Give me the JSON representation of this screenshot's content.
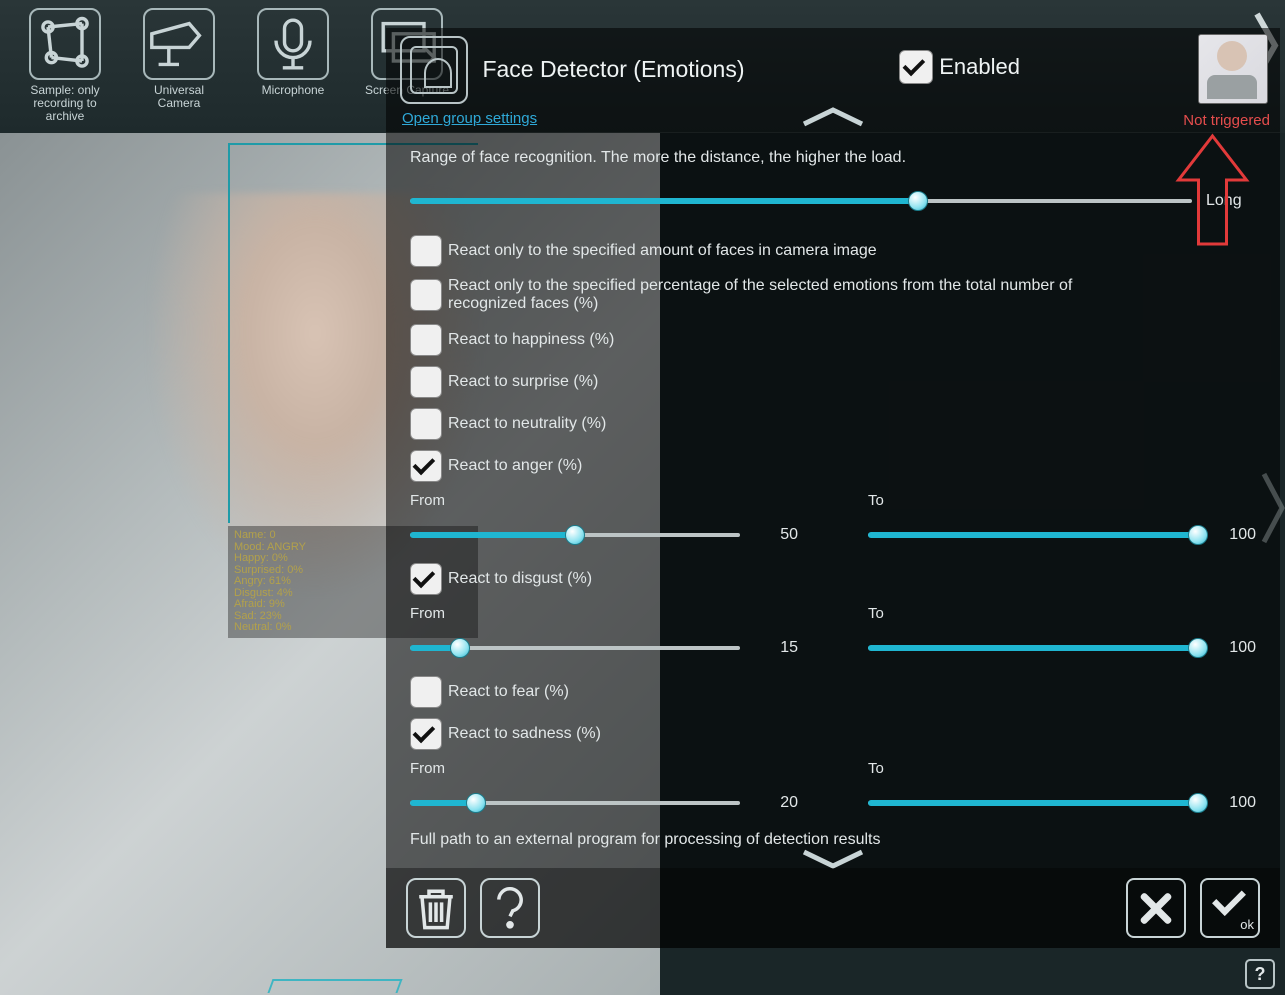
{
  "toolbar": {
    "items": [
      {
        "label": "Sample: only recording to archive"
      },
      {
        "label": "Universal Camera"
      },
      {
        "label": "Microphone"
      },
      {
        "label": "Screen Capture"
      }
    ]
  },
  "panel": {
    "title": "Face Detector (Emotions)",
    "open_group": "Open group settings",
    "enabled_label": "Enabled",
    "enabled_checked": true,
    "not_triggered": "Not triggered",
    "desc": "Range of face recognition. The more the distance, the higher the load.",
    "range_suffix": "Long",
    "range_percent": 65,
    "opts": {
      "faces_count": {
        "label": "React only to the specified amount of faces in camera image",
        "checked": false
      },
      "faces_percent": {
        "label": "React only to the specified percentage of the selected emotions from the total number of recognized faces (%)",
        "checked": false
      },
      "happiness": {
        "label": "React to happiness (%)",
        "checked": false
      },
      "surprise": {
        "label": "React to surprise (%)",
        "checked": false
      },
      "neutrality": {
        "label": "React to neutrality (%)",
        "checked": false
      },
      "anger": {
        "label": "React to anger (%)",
        "checked": true,
        "from": 50,
        "to": 100
      },
      "disgust": {
        "label": "React to disgust (%)",
        "checked": true,
        "from": 15,
        "to": 100
      },
      "fear": {
        "label": "React to fear (%)",
        "checked": false
      },
      "sadness": {
        "label": "React to sadness (%)",
        "checked": true,
        "from": 20,
        "to": 100
      }
    },
    "from_label": "From",
    "to_label": "To",
    "ext_program": "Full path to an external program for processing of detection results",
    "ok_label": "ok"
  },
  "overlay": {
    "name": "Name: 0",
    "mood": "Mood: ANGRY",
    "happy": "Happy: 0%",
    "surprised": "Surprised: 0%",
    "angry": "Angry: 61%",
    "disgust": "Disgust: 4%",
    "afraid": "Afraid: 9%",
    "sad": "Sad: 23%",
    "neutral": "Neutral: 0%"
  },
  "help_icon": "?"
}
